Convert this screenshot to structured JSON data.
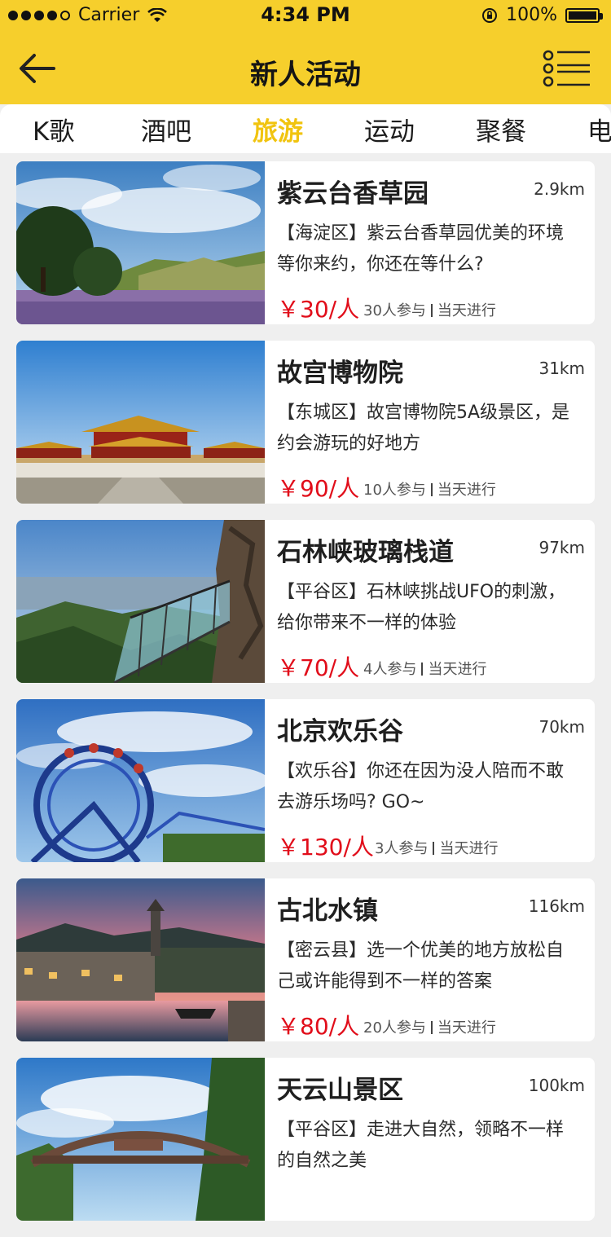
{
  "status_bar": {
    "carrier": "Carrier",
    "time": "4:34 PM",
    "battery": "100%"
  },
  "header": {
    "title": "新人活动",
    "back_icon": "arrow-left-icon",
    "menu_icon": "list-menu-icon",
    "bg_color": "#f6cf2c"
  },
  "tabs": [
    {
      "label": "K歌",
      "active": false
    },
    {
      "label": "酒吧",
      "active": false
    },
    {
      "label": "旅游",
      "active": true
    },
    {
      "label": "运动",
      "active": false
    },
    {
      "label": "聚餐",
      "active": false
    },
    {
      "label": "电",
      "active": false
    }
  ],
  "cards": [
    {
      "name": "紫云台香草园",
      "distance": "2.9km",
      "description": "【海淀区】紫云台香草园优美的环境等你来约，你还在等什么?",
      "price": "￥30/人",
      "participants": "30人参与",
      "when": "当天进行"
    },
    {
      "name": "故宫博物院",
      "distance": "31km",
      "description": "【东城区】故宫博物院5A级景区，是约会游玩的好地方",
      "price": "￥90/人",
      "participants": "10人参与",
      "when": "当天进行"
    },
    {
      "name": "石林峡玻璃栈道",
      "distance": "97km",
      "description": "【平谷区】石林峡挑战UFO的刺激，给你带来不一样的体验",
      "price": "￥70/人",
      "participants": "4人参与",
      "when": "当天进行"
    },
    {
      "name": "北京欢乐谷",
      "distance": "70km",
      "description": "【欢乐谷】你还在因为没人陪而不敢去游乐场吗? GO~",
      "price": "￥130/人",
      "participants": "3人参与",
      "when": "当天进行"
    },
    {
      "name": "古北水镇",
      "distance": "116km",
      "description": "【密云县】选一个优美的地方放松自己或许能得到不一样的答案",
      "price": "￥80/人",
      "participants": "20人参与",
      "when": "当天进行"
    },
    {
      "name": "天云山景区",
      "distance": "100km",
      "description": "【平谷区】走进大自然，领略不一样的自然之美",
      "price": "",
      "participants": "",
      "when": ""
    }
  ],
  "colors": {
    "accent": "#f1c40f",
    "price": "#e10d1a",
    "background": "#efefef"
  }
}
